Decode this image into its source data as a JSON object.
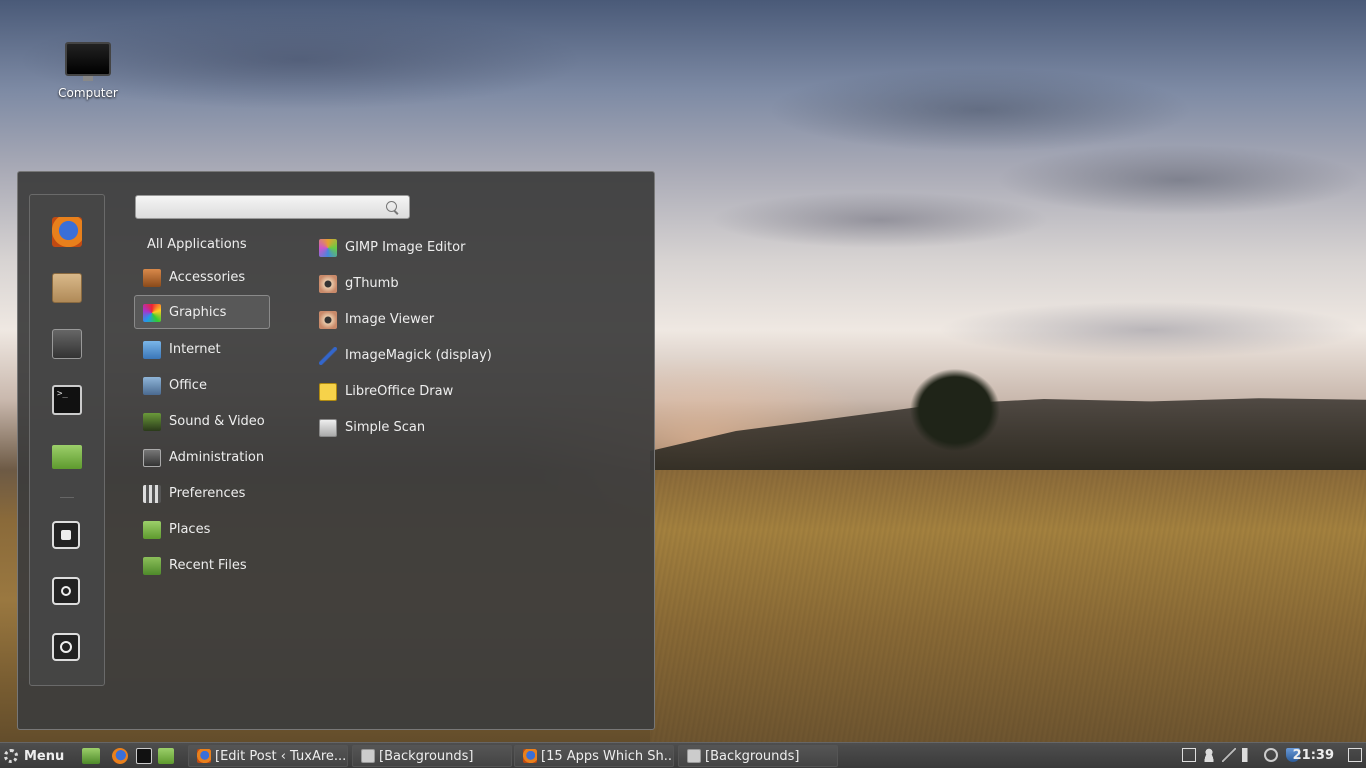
{
  "desktop": {
    "icons": [
      {
        "label": "Computer",
        "icon": "computer-icon"
      }
    ]
  },
  "menu": {
    "search": {
      "value": "",
      "placeholder": ""
    },
    "favorites": [
      {
        "name": "firefox-icon"
      },
      {
        "name": "software-manager-icon"
      },
      {
        "name": "system-settings-icon"
      },
      {
        "name": "terminal-icon"
      },
      {
        "name": "home-folder-icon"
      },
      {
        "name": "lock-icon"
      },
      {
        "name": "logout-icon"
      },
      {
        "name": "power-icon"
      }
    ],
    "categories": [
      {
        "label": "All Applications"
      },
      {
        "label": "Accessories",
        "icon": "accessories-icon"
      },
      {
        "label": "Graphics",
        "icon": "graphics-icon",
        "selected": true
      },
      {
        "label": "Internet",
        "icon": "internet-icon"
      },
      {
        "label": "Office",
        "icon": "office-icon"
      },
      {
        "label": "Sound & Video",
        "icon": "sound-video-icon"
      },
      {
        "label": "Administration",
        "icon": "administration-icon"
      },
      {
        "label": "Preferences",
        "icon": "preferences-icon"
      },
      {
        "label": "Places",
        "icon": "places-icon"
      },
      {
        "label": "Recent Files",
        "icon": "recent-files-icon"
      }
    ],
    "apps": [
      {
        "label": "GIMP Image Editor",
        "icon": "gimp-icon"
      },
      {
        "label": "gThumb",
        "icon": "gthumb-icon"
      },
      {
        "label": "Image Viewer",
        "icon": "image-viewer-icon"
      },
      {
        "label": "ImageMagick (display)",
        "icon": "imagemagick-icon"
      },
      {
        "label": "LibreOffice Draw",
        "icon": "libreoffice-draw-icon"
      },
      {
        "label": "Simple Scan",
        "icon": "simple-scan-icon"
      }
    ]
  },
  "taskbar": {
    "menu_label": "Menu",
    "tasks": [
      {
        "label": "[Edit Post ‹ TuxAre...",
        "icon": "firefox-icon"
      },
      {
        "label": "[Backgrounds]",
        "icon": "file-manager-icon"
      },
      {
        "label": "[15 Apps Which Sh...",
        "icon": "firefox-icon"
      },
      {
        "label": "[Backgrounds]",
        "icon": "file-manager-icon"
      }
    ],
    "clock": "21:39"
  }
}
